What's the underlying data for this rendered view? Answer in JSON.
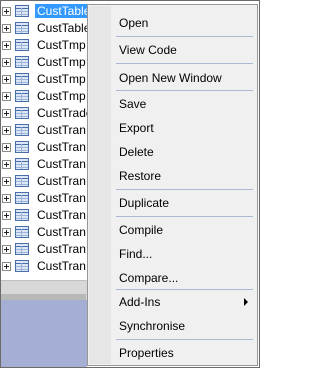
{
  "tree": {
    "items": [
      {
        "label": "CustTable"
      },
      {
        "label": "CustTable"
      },
      {
        "label": "CustTmp"
      },
      {
        "label": "CustTmp"
      },
      {
        "label": "CustTmp"
      },
      {
        "label": "CustTmp"
      },
      {
        "label": "CustTrade"
      },
      {
        "label": "CustTran"
      },
      {
        "label": "CustTran"
      },
      {
        "label": "CustTran"
      },
      {
        "label": "CustTran"
      },
      {
        "label": "CustTran"
      },
      {
        "label": "CustTran"
      },
      {
        "label": "CustTran"
      },
      {
        "label": "CustTran"
      },
      {
        "label": "CustTran"
      }
    ]
  },
  "context_menu": {
    "items": {
      "open": "Open",
      "view_code": "View Code",
      "open_new_window": "Open New Window",
      "save": "Save",
      "export": "Export",
      "delete": "Delete",
      "restore": "Restore",
      "duplicate": "Duplicate",
      "compile": "Compile",
      "find": "Find...",
      "compare": "Compare...",
      "add_ins": "Add-Ins",
      "synchronise": "Synchronise",
      "properties": "Properties"
    }
  },
  "colors": {
    "selection": "#3399ff",
    "menu_background": "#f0f0f0",
    "separator": "#a9b9d0",
    "bottom_pane": "#a5aed3"
  }
}
